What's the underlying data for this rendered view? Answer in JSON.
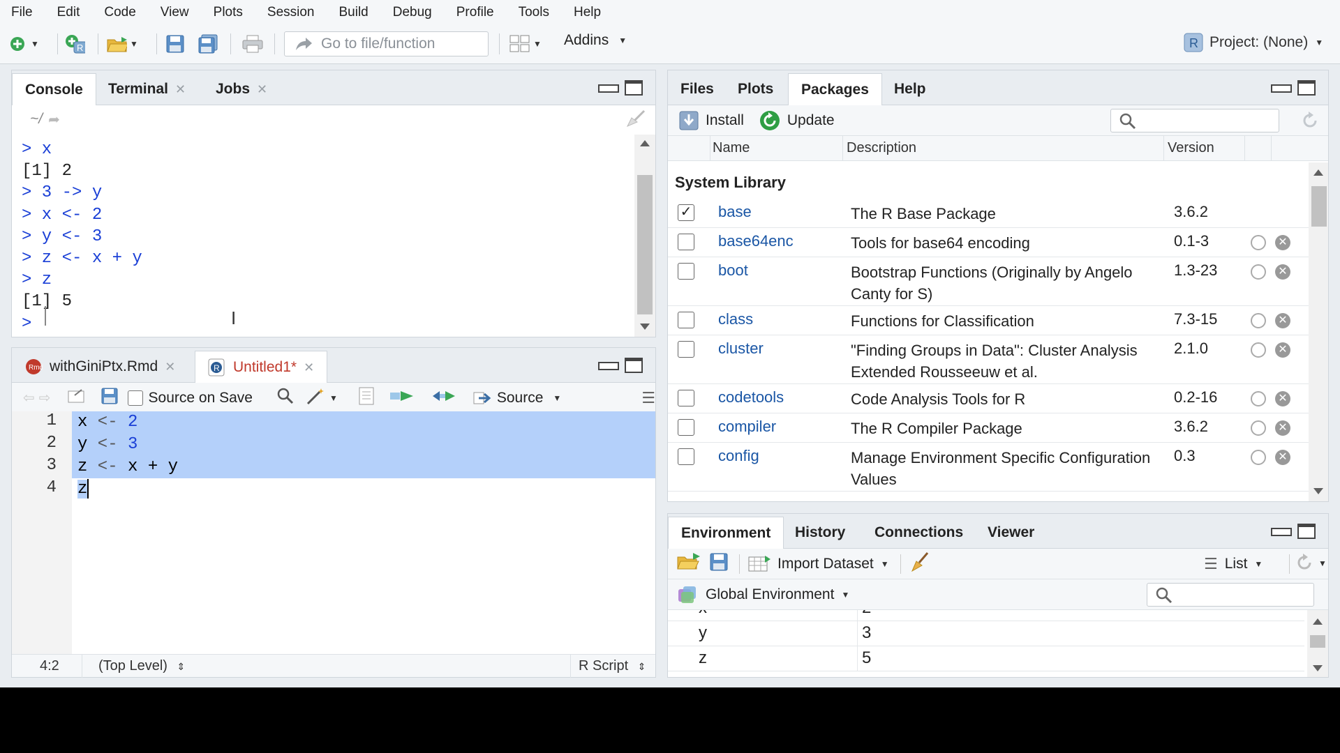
{
  "menu": [
    "File",
    "Edit",
    "Code",
    "View",
    "Plots",
    "Session",
    "Build",
    "Debug",
    "Profile",
    "Tools",
    "Help"
  ],
  "toolbar": {
    "goto_placeholder": "Go to file/function",
    "addins_label": "Addins",
    "project_label": "Project: (None)"
  },
  "console_pane": {
    "tabs": [
      "Console",
      "Terminal",
      "Jobs"
    ],
    "path": "~/",
    "lines": [
      {
        "prompt": ">",
        "text": " x",
        "kind": "in"
      },
      {
        "prompt": "",
        "text": "[1] 2",
        "kind": "out"
      },
      {
        "prompt": ">",
        "text": " 3 -> y",
        "kind": "in"
      },
      {
        "prompt": ">",
        "text": " x <- 2",
        "kind": "in"
      },
      {
        "prompt": ">",
        "text": " y <- 3",
        "kind": "in"
      },
      {
        "prompt": ">",
        "text": " z <- x + y",
        "kind": "in"
      },
      {
        "prompt": ">",
        "text": " z",
        "kind": "in"
      },
      {
        "prompt": "",
        "text": "[1] 5",
        "kind": "out"
      },
      {
        "prompt": ">",
        "text": " ",
        "kind": "in"
      }
    ]
  },
  "editor_pane": {
    "tabs": [
      {
        "label": "withGiniPtx.Rmd",
        "modified": false
      },
      {
        "label": "Untitled1*",
        "modified": true
      }
    ],
    "source_on_save": "Source on Save",
    "source_label": "Source",
    "line_numbers": [
      "1",
      "2",
      "3",
      "4"
    ],
    "code": [
      {
        "a": "x",
        "op": " <- ",
        "b": "2"
      },
      {
        "a": "y",
        "op": " <- ",
        "b": "3"
      },
      {
        "a": "z",
        "op": " <- ",
        "b": "x + y"
      },
      {
        "a": "z",
        "op": "",
        "b": ""
      }
    ],
    "status": {
      "pos": "4:2",
      "scope": "(Top Level)",
      "type": "R Script"
    }
  },
  "files_pane": {
    "tabs": [
      "Files",
      "Plots",
      "Packages",
      "Help"
    ],
    "install_label": "Install",
    "update_label": "Update",
    "columns": [
      "Name",
      "Description",
      "Version"
    ],
    "section": "System Library",
    "packages": [
      {
        "name": "base",
        "desc": "The R Base Package",
        "version": "3.6.2",
        "checked": true
      },
      {
        "name": "base64enc",
        "desc": "Tools for base64 encoding",
        "version": "0.1-3",
        "checked": false
      },
      {
        "name": "boot",
        "desc": "Bootstrap Functions (Originally by Angelo Canty for S)",
        "version": "1.3-23",
        "checked": false
      },
      {
        "name": "class",
        "desc": "Functions for Classification",
        "version": "7.3-15",
        "checked": false
      },
      {
        "name": "cluster",
        "desc": "\"Finding Groups in Data\": Cluster Analysis Extended Rousseeuw et al.",
        "version": "2.1.0",
        "checked": false
      },
      {
        "name": "codetools",
        "desc": "Code Analysis Tools for R",
        "version": "0.2-16",
        "checked": false
      },
      {
        "name": "compiler",
        "desc": "The R Compiler Package",
        "version": "3.6.2",
        "checked": false
      },
      {
        "name": "config",
        "desc": "Manage Environment Specific Configuration Values",
        "version": "0.3",
        "checked": false
      }
    ]
  },
  "env_pane": {
    "tabs": [
      "Environment",
      "History",
      "Connections",
      "Viewer"
    ],
    "import_label": "Import Dataset",
    "list_label": "List",
    "scope_label": "Global Environment",
    "vars": [
      {
        "name": "x",
        "value": "2"
      },
      {
        "name": "y",
        "value": "3"
      },
      {
        "name": "z",
        "value": "5"
      }
    ]
  }
}
